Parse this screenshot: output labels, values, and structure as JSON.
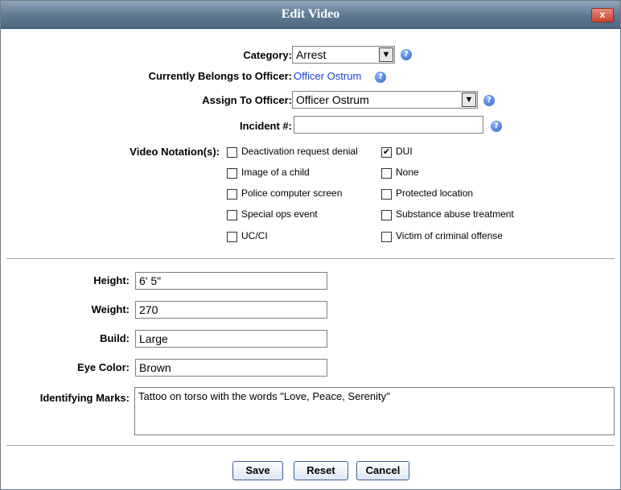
{
  "dialog": {
    "title": "Edit Video",
    "close_label": "x"
  },
  "top_fields": {
    "category_label": "Category:",
    "category_value": "Arrest",
    "belongs_label": "Currently Belongs to Officer:",
    "belongs_value": "Officer Ostrum",
    "assign_label": "Assign To Officer:",
    "assign_value": "Officer Ostrum",
    "incident_label": "Incident #:",
    "incident_value": "",
    "help_glyph": "?"
  },
  "notations": {
    "label": "Video Notation(s):",
    "items": [
      {
        "label": "Deactivation request denial",
        "checked": false
      },
      {
        "label": "DUI",
        "checked": true
      },
      {
        "label": "Image of a child",
        "checked": false
      },
      {
        "label": "None",
        "checked": false
      },
      {
        "label": "Police computer screen",
        "checked": false
      },
      {
        "label": "Protected location",
        "checked": false
      },
      {
        "label": "Special ops event",
        "checked": false
      },
      {
        "label": "Substance abuse treatment",
        "checked": false
      },
      {
        "label": "UC/CI",
        "checked": false
      },
      {
        "label": "Victim of criminal offense",
        "checked": false
      }
    ]
  },
  "subject": {
    "height_label": "Height:",
    "height_value": "6' 5\"",
    "weight_label": "Weight:",
    "weight_value": "270",
    "build_label": "Build:",
    "build_value": "Large",
    "eye_label": "Eye Color:",
    "eye_value": "Brown",
    "marks_label": "Identifying Marks:",
    "marks_value": "Tattoo on torso with the words \"Love, Peace, Serenity\""
  },
  "buttons": {
    "save": "Save",
    "reset": "Reset",
    "cancel": "Cancel"
  },
  "colors": {
    "titlebar": "#5f7891",
    "link": "#1a3fd6",
    "help_icon": "#2f63c8",
    "close": "#c6442f"
  }
}
